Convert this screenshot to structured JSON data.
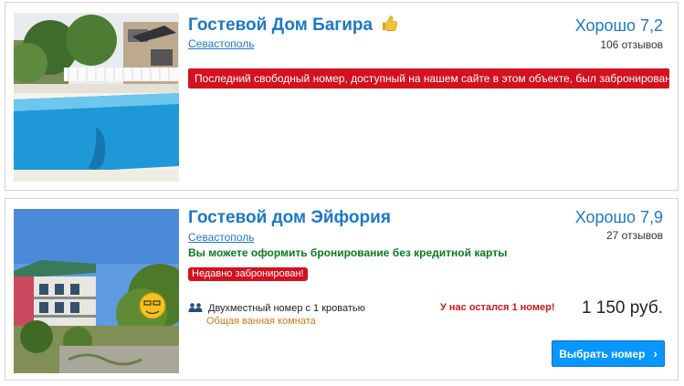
{
  "listings": [
    {
      "title": "Гостевой Дом Багира",
      "badge_icon": "thumbs-up-icon",
      "city": "Севастополь",
      "score": "Хорошо 7,2",
      "reviews": "106 отзывов",
      "alert": "Последний свободный номер, доступный на нашем сайте в этом объекте, был забронирован"
    },
    {
      "title": "Гостевой дом Эйфория",
      "city": "Севастополь",
      "score": "Хорошо 7,9",
      "reviews": "27 отзывов",
      "no_card": "Вы можете оформить бронирование без кредитной карты",
      "recent": "Недавно забронирован!",
      "room_icon": "people-icon",
      "room_name": "Двухместный номер с 1 кроватью",
      "room_sub": "Общая ванная комната",
      "left": "У нас остался 1 номер!",
      "price": "1 150 руб.",
      "button": "Выбрать номер",
      "button_icon": "chevron-right-icon"
    }
  ],
  "colors": {
    "link_blue": "#1b78c9",
    "alert_red": "#d4111e",
    "green_text": "#0a7a1f",
    "button_blue": "#0896ff",
    "orange_text": "#c47a12"
  }
}
